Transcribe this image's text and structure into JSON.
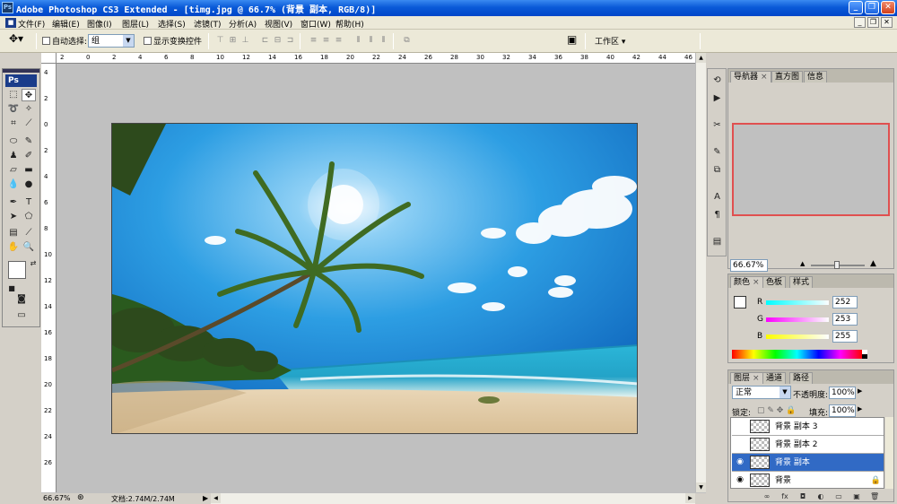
{
  "window": {
    "title": "Adobe Photoshop CS3 Extended - [timg.jpg @ 66.7% (背景 副本, RGB/8)]",
    "logo_text": "Ps",
    "min_label": "_",
    "restore_label": "❐",
    "close_label": "✕"
  },
  "menu": {
    "items": [
      "文件(F)",
      "编辑(E)",
      "图像(I)",
      "图层(L)",
      "选择(S)",
      "滤镜(T)",
      "分析(A)",
      "视图(V)",
      "窗口(W)",
      "帮助(H)"
    ],
    "doc_min": "_",
    "doc_restore": "❐",
    "doc_close": "✕"
  },
  "options": {
    "auto_select_label": "自动选择:",
    "auto_select_value": "组",
    "show_transform_label": "显示变换控件",
    "workspace_label": "工作区 ▾"
  },
  "rulers": {
    "h_ticks": [
      "2",
      "0",
      "2",
      "4",
      "6",
      "8",
      "10",
      "12",
      "14",
      "16",
      "18",
      "20",
      "22",
      "24",
      "26",
      "28",
      "30",
      "32",
      "34",
      "36",
      "38",
      "40",
      "42",
      "44",
      "46"
    ],
    "v_ticks": [
      "4",
      "2",
      "0",
      "2",
      "4",
      "6",
      "8",
      "10",
      "12",
      "14",
      "16",
      "18",
      "20",
      "22",
      "24",
      "26"
    ]
  },
  "status": {
    "zoom": "66.67%",
    "doc_info": "文档:2.74M/2.74M"
  },
  "toolbox": {
    "logo": "Ps"
  },
  "navigator": {
    "tabs": [
      "导航器",
      "直方图",
      "信息"
    ],
    "zoom": "66.67%"
  },
  "color": {
    "tabs": [
      "颜色",
      "色板",
      "样式"
    ],
    "channels": [
      {
        "label": "R",
        "value": "252"
      },
      {
        "label": "G",
        "value": "253"
      },
      {
        "label": "B",
        "value": "255"
      }
    ]
  },
  "layers": {
    "tabs": [
      "图层",
      "通道",
      "路径"
    ],
    "blend_mode": "正常",
    "opacity_label": "不透明度:",
    "opacity_value": "100%",
    "lock_label": "锁定:",
    "fill_label": "填充:",
    "fill_value": "100%",
    "items": [
      {
        "name": "背景 副本 3",
        "visible": false,
        "selected": false
      },
      {
        "name": "背景 副本 2",
        "visible": false,
        "selected": false
      },
      {
        "name": "背景 副本",
        "visible": true,
        "selected": true
      },
      {
        "name": "背景",
        "visible": true,
        "selected": false
      }
    ]
  },
  "colors": {
    "title_bar": "#0a5ad8",
    "workspace": "#c0c0c0",
    "selected_layer": "#316ac5",
    "nav_frame": "#e05050"
  }
}
